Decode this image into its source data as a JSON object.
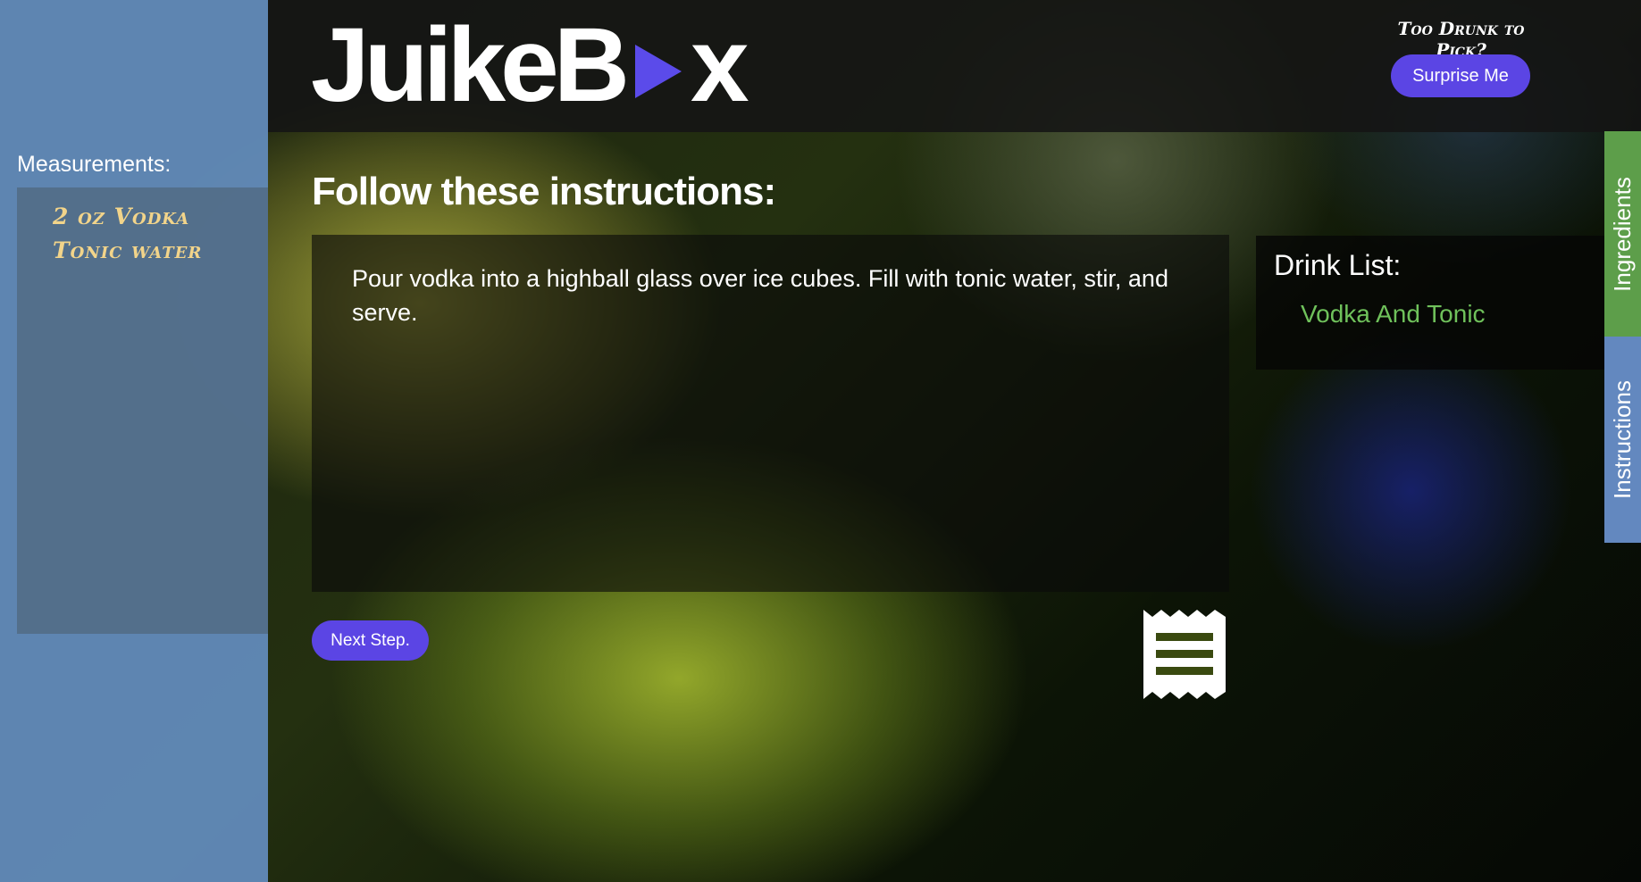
{
  "header": {
    "logo_text_left": "JuikeB",
    "logo_text_right": "x",
    "random_caption": "Too Drunk to Pick?",
    "surprise_button": "Surprise Me"
  },
  "sidebar": {
    "measurements_label": "Measurements:",
    "measurements": [
      "2 oz Vodka",
      "Tonic water"
    ]
  },
  "main": {
    "title": "Follow these instructions:",
    "instructions": "Pour vodka into a highball glass over ice cubes. Fill with tonic water, stir, and serve.",
    "next_button": "Next Step."
  },
  "drink_list": {
    "title": "Drink List:",
    "items": [
      "Vodka And Tonic"
    ]
  },
  "side_tabs": {
    "ingredients": "Ingredients",
    "instructions": "Instructions"
  },
  "colors": {
    "accent": "#5b45e4",
    "ingredients_tab": "#5d9e4a",
    "instructions_tab": "#6388bf",
    "drink_item": "#6fc15b",
    "measurement_text": "#f2d48a"
  },
  "icons": {
    "logo_play": "play-icon",
    "receipt": "receipt-icon"
  }
}
